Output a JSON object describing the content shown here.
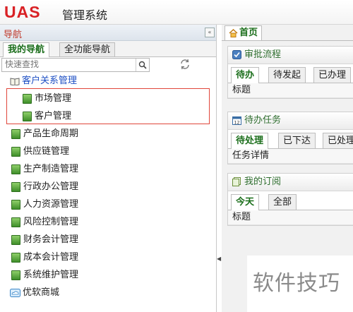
{
  "header": {
    "logo": "UAS",
    "title": "管理系统"
  },
  "sidebar": {
    "title": "导航",
    "collapse_glyph": "«",
    "tabs": [
      {
        "label": "我的导航"
      },
      {
        "label": "全功能导航"
      }
    ],
    "search_placeholder": "快速查找",
    "tree": [
      {
        "label": "客户关系管理"
      },
      {
        "label": "市场管理"
      },
      {
        "label": "客户管理"
      },
      {
        "label": "产品生命周期"
      },
      {
        "label": "供应链管理"
      },
      {
        "label": "生产制造管理"
      },
      {
        "label": "行政办公管理"
      },
      {
        "label": "人力资源管理"
      },
      {
        "label": "风险控制管理"
      },
      {
        "label": "财务会计管理"
      },
      {
        "label": "成本会计管理"
      },
      {
        "label": "系统维护管理"
      },
      {
        "label": "优软商城"
      }
    ]
  },
  "content": {
    "home_tab": "首页",
    "panels": [
      {
        "title": "审批流程",
        "tabs": [
          "待办",
          "待发起",
          "已办理"
        ],
        "row": "标题"
      },
      {
        "title": "待办任务",
        "tabs": [
          "待处理",
          "已下达",
          "已处理"
        ],
        "row": "任务详情"
      },
      {
        "title": "我的订阅",
        "tabs": [
          "今天",
          "全部"
        ],
        "row": "标题"
      }
    ]
  },
  "watermark": "软件技巧",
  "colors": {
    "logo": "#d92125",
    "nav_title": "#c0392b",
    "active_tab": "#1b6e1b",
    "highlight": "#e0463a"
  }
}
